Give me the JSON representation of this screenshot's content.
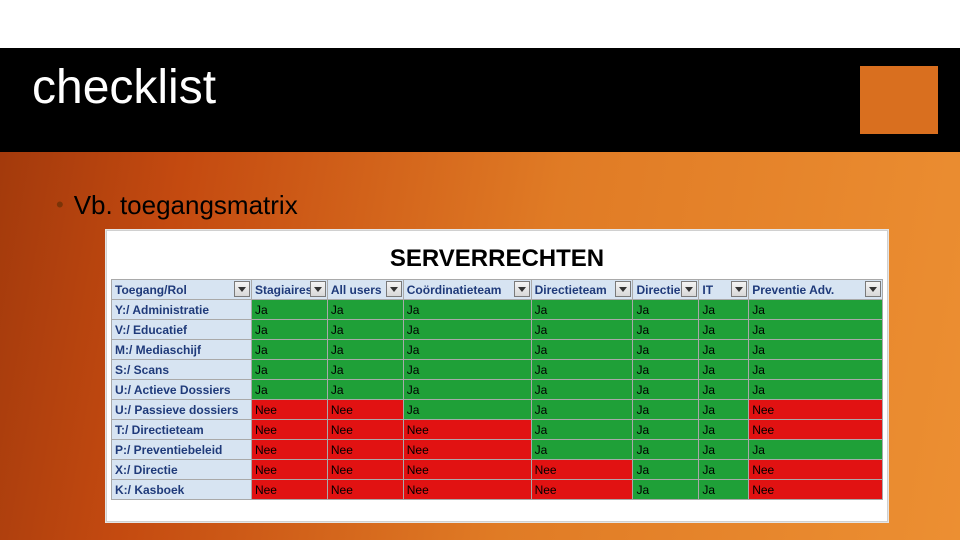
{
  "title": "checklist",
  "bullet": "Vb. toegangsmatrix",
  "sheet_heading": "SERVERRECHTEN",
  "columns": [
    "Toegang/Rol",
    "Stagiaires",
    "All users",
    "Coördinatieteam",
    "Directieteam",
    "Directie",
    "IT",
    "Preventie Adv."
  ],
  "rows": [
    {
      "label": "Y:/ Administratie",
      "cells": [
        "Ja",
        "Ja",
        "Ja",
        "Ja",
        "Ja",
        "Ja",
        "Ja"
      ]
    },
    {
      "label": "V:/ Educatief",
      "cells": [
        "Ja",
        "Ja",
        "Ja",
        "Ja",
        "Ja",
        "Ja",
        "Ja"
      ]
    },
    {
      "label": "M:/ Mediaschijf",
      "cells": [
        "Ja",
        "Ja",
        "Ja",
        "Ja",
        "Ja",
        "Ja",
        "Ja"
      ]
    },
    {
      "label": "S:/ Scans",
      "cells": [
        "Ja",
        "Ja",
        "Ja",
        "Ja",
        "Ja",
        "Ja",
        "Ja"
      ]
    },
    {
      "label": "U:/ Actieve Dossiers",
      "cells": [
        "Ja",
        "Ja",
        "Ja",
        "Ja",
        "Ja",
        "Ja",
        "Ja"
      ]
    },
    {
      "label": "U:/ Passieve dossiers",
      "cells": [
        "Nee",
        "Nee",
        "Ja",
        "Ja",
        "Ja",
        "Ja",
        "Nee"
      ]
    },
    {
      "label": "T:/ Directieteam",
      "cells": [
        "Nee",
        "Nee",
        "Nee",
        "Ja",
        "Ja",
        "Ja",
        "Nee"
      ]
    },
    {
      "label": "P:/ Preventiebeleid",
      "cells": [
        "Nee",
        "Nee",
        "Nee",
        "Ja",
        "Ja",
        "Ja",
        "Ja"
      ]
    },
    {
      "label": "X:/ Directie",
      "cells": [
        "Nee",
        "Nee",
        "Nee",
        "Nee",
        "Ja",
        "Ja",
        "Nee"
      ]
    },
    {
      "label": "K:/ Kasboek",
      "cells": [
        "Nee",
        "Nee",
        "Nee",
        "Nee",
        "Ja",
        "Ja",
        "Nee"
      ]
    }
  ]
}
